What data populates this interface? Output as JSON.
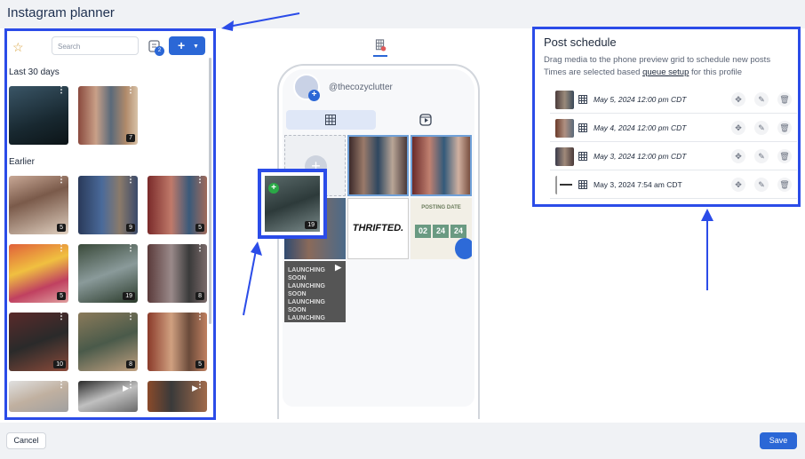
{
  "app": {
    "title": "Instagram planner"
  },
  "library": {
    "search_placeholder": "Search",
    "bulk_badge": "2",
    "add_label": "+",
    "sections": {
      "recent": "Last 30 days",
      "earlier": "Earlier"
    },
    "recent_items": [
      {
        "count": ""
      },
      {
        "count": "7"
      }
    ],
    "earlier_items": [
      {
        "count": "5"
      },
      {
        "count": "9"
      },
      {
        "count": "5"
      },
      {
        "count": "5"
      },
      {
        "count": "19"
      },
      {
        "count": "8"
      },
      {
        "count": "10"
      },
      {
        "count": "8"
      },
      {
        "count": "5"
      },
      {
        "count": ""
      },
      {
        "count": ""
      },
      {
        "count": ""
      }
    ]
  },
  "preview": {
    "handle": "@thecozyclutter",
    "tiles": {
      "thrifted": "THRIFTED.",
      "posting_title": "POSTING DATE",
      "posting_nums": [
        "02",
        "24",
        "24"
      ],
      "launch": "LAUNCHING SOON LAUNCHING SOON LAUNCHING SOON LAUNCHING SOON LAUNCHING SOON"
    },
    "drag_count": "19"
  },
  "schedule": {
    "title": "Post schedule",
    "desc_1": "Drag media to the phone preview grid to schedule new posts",
    "desc_2_pre": "Times are selected based ",
    "desc_2_link": "queue setup",
    "desc_2_post": " for this profile",
    "items": [
      {
        "date": "May 5, 2024 12:00 pm  CDT"
      },
      {
        "date": "May 4, 2024 12:00 pm  CDT"
      },
      {
        "date": "May 3, 2024 12:00 pm  CDT"
      },
      {
        "date": "May 3, 2024 7:54 am  CDT"
      }
    ]
  },
  "footer": {
    "cancel": "Cancel",
    "save": "Save"
  },
  "colors": {
    "accent": "#2b67d6",
    "highlight": "#2b4ce8"
  }
}
